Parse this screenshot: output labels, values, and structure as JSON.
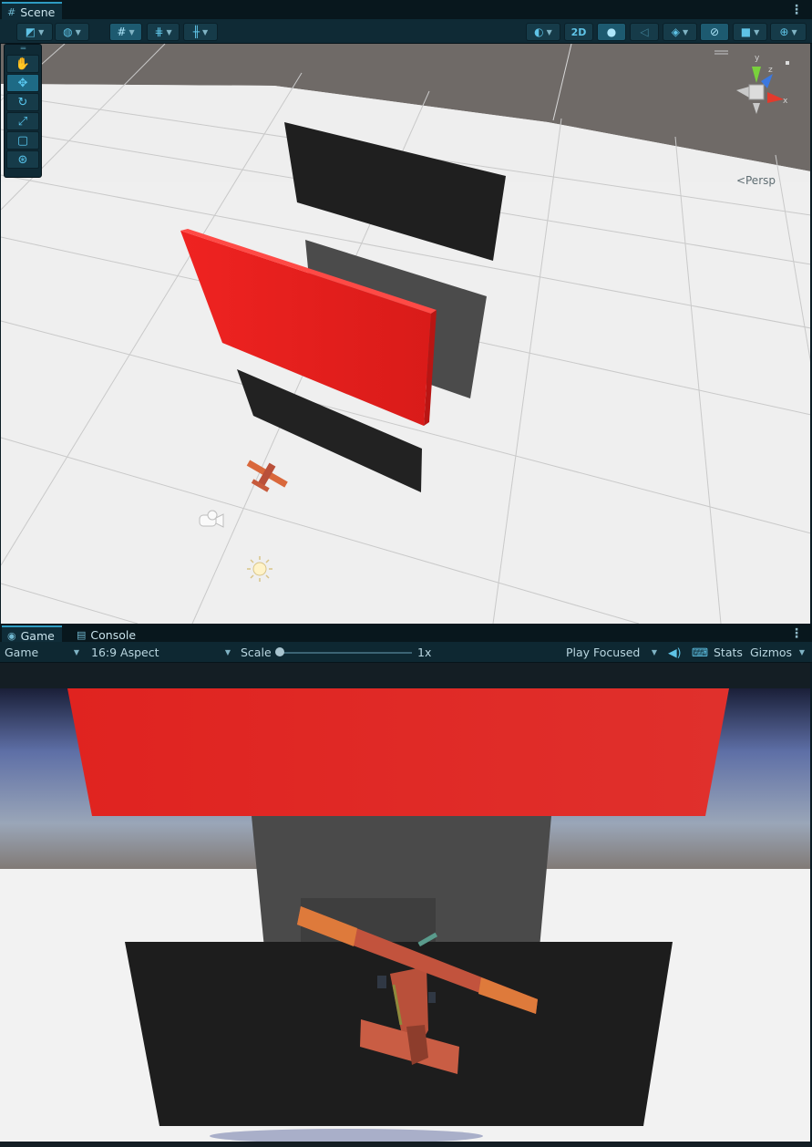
{
  "scene_panel": {
    "tab_label": "Scene",
    "toolbar": {
      "two_d_label": "2D"
    },
    "tools": [
      "hand",
      "move",
      "rotate",
      "scale",
      "rect",
      "transform"
    ],
    "gizmo": {
      "axis_y": "y",
      "axis_z": "z",
      "axis_x": "x",
      "projection_label": "Persp"
    }
  },
  "game_panel": {
    "tabs": [
      {
        "label": "Game",
        "active": true
      },
      {
        "label": "Console",
        "active": false
      }
    ],
    "toolbar": {
      "display_select": "Game",
      "aspect_select": "16:9 Aspect",
      "scale_label": "Scale",
      "scale_value": "1x",
      "play_mode_select": "Play Focused",
      "stats_label": "Stats",
      "gizmos_label": "Gizmos"
    }
  },
  "colors": {
    "accent": "#2e9bc2",
    "panel_dark": "#08171d",
    "toolbar": "#0f2a35",
    "red_wall": "#e8201e",
    "dark_wall": "#1e1e1e",
    "grey_wall": "#4a4a4a",
    "ground": "#f1f1f1"
  }
}
